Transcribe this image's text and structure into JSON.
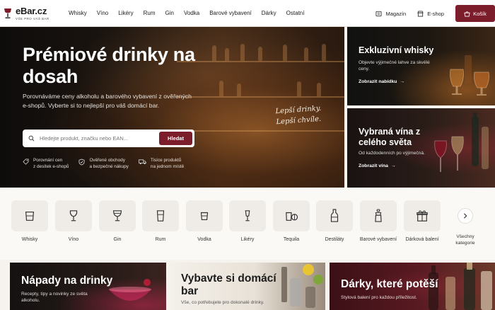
{
  "header": {
    "logo": {
      "name": "eBar.cz",
      "tagline": "VŠE PRO VÁŠ BAR"
    },
    "nav": [
      "Whisky",
      "Víno",
      "Likéry",
      "Rum",
      "Gin",
      "Vodka",
      "Barové vybavení",
      "Dárky",
      "Ostatní"
    ],
    "magazine": "Magazín",
    "eshop": "E-shop",
    "cart": "Košík",
    "accent": "#7c1d2b"
  },
  "hero": {
    "title": "Prémiové drinky na dosah",
    "subtitle": "Porovnáváme ceny alkoholu a barového vybavení z ověřených e-shopů. Vyberte si to nejlepší pro váš domácí bar.",
    "search_placeholder": "Hledejte produkt, značku nebo EAN...",
    "search_button": "Hledat",
    "features": [
      {
        "icon": "tag-icon",
        "line1": "Porovnání cen",
        "line2": "z desítek e-shopů"
      },
      {
        "icon": "shield-check-icon",
        "line1": "Ověřené obchody",
        "line2": "a bezpečné nákupy"
      },
      {
        "icon": "truck-icon",
        "line1": "Tisíce produktů",
        "line2": "na jednom místě"
      }
    ],
    "script_line1": "Lepší drinky.",
    "script_line2": "Lepší chvíle."
  },
  "cards": {
    "whisky": {
      "title": "Exkluzivní whisky",
      "subtitle": "Objevte výjimečné lahve za skvělé ceny.",
      "link": "Zobrazit nabídku"
    },
    "wine": {
      "title": "Vybraná vína z celého světa",
      "subtitle": "Od každodenních po výjimečná.",
      "link": "Zobrazit vína"
    }
  },
  "categories": {
    "items": [
      {
        "label": "Whisky",
        "icon": "whisky-glass-icon"
      },
      {
        "label": "Víno",
        "icon": "wine-glass-icon"
      },
      {
        "label": "Gin",
        "icon": "gin-glass-icon"
      },
      {
        "label": "Rum",
        "icon": "rum-glass-icon"
      },
      {
        "label": "Vodka",
        "icon": "shot-glass-icon"
      },
      {
        "label": "Likéry",
        "icon": "liqueur-glass-icon"
      },
      {
        "label": "Tequila",
        "icon": "tequila-icon"
      },
      {
        "label": "Destiláty",
        "icon": "bottle-icon"
      },
      {
        "label": "Barové vybavení",
        "icon": "shaker-icon"
      },
      {
        "label": "Dárková balení",
        "icon": "gift-icon"
      }
    ],
    "all_label": "Všechny kategorie"
  },
  "promos": {
    "drinks": {
      "title": "Nápady na drinky",
      "subtitle": "Recepty, tipy a novinky ze světa alkoholu."
    },
    "bar": {
      "title": "Vybavte si domácí bar",
      "subtitle": "Vše, co potřebujete pro dokonalé drinky."
    },
    "gifts": {
      "title": "Dárky, které potěší",
      "subtitle": "Stylová balení pro každou příležitost."
    }
  }
}
